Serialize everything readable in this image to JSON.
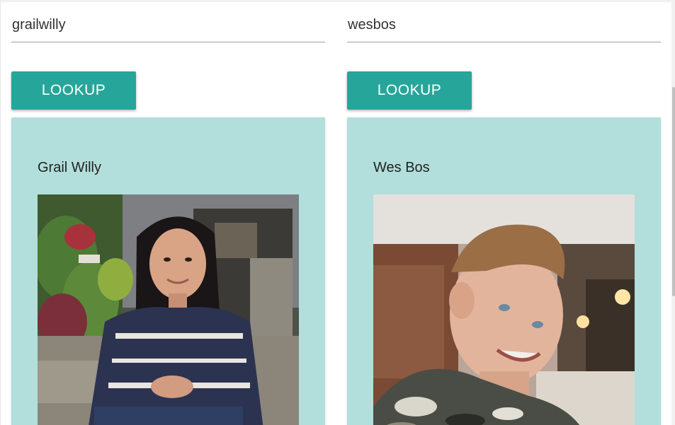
{
  "users": [
    {
      "username": "grailwilly",
      "button_label": "LOOKUP",
      "display_name": "Grail Willy"
    },
    {
      "username": "wesbos",
      "button_label": "LOOKUP",
      "display_name": "Wes Bos"
    }
  ],
  "colors": {
    "button": "#26a69a",
    "card": "#b2dfdb"
  }
}
